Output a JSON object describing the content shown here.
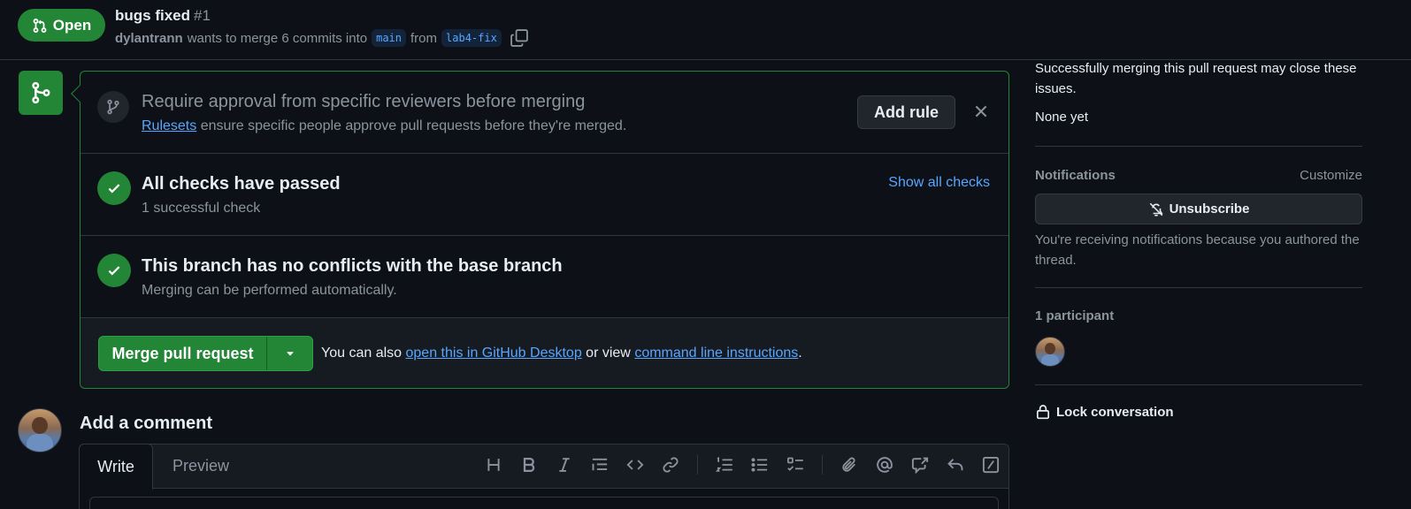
{
  "header": {
    "state": "Open",
    "title": "bugs fixed",
    "number": "#1",
    "author": "dylantrann",
    "merge_text": "wants to merge 6 commits into",
    "base_branch": "main",
    "from_text": "from",
    "head_branch": "lab4-fix"
  },
  "merge_box": {
    "rule_title": "Require approval from specific reviewers before merging",
    "rule_link": "Rulesets",
    "rule_desc": "ensure specific people approve pull requests before they're merged.",
    "add_rule": "Add rule",
    "checks_title": "All checks have passed",
    "checks_sub": "1 successful check",
    "show_checks": "Show all checks",
    "conflict_title": "This branch has no conflicts with the base branch",
    "conflict_sub": "Merging can be performed automatically.",
    "merge_button": "Merge pull request",
    "hint_pre": "You can also",
    "hint_link1": "open this in GitHub Desktop",
    "hint_mid": "or view",
    "hint_link2": "command line instructions",
    "hint_end": "."
  },
  "comment": {
    "heading": "Add a comment",
    "tab_write": "Write",
    "tab_preview": "Preview",
    "toolbar_icons": [
      "heading-icon",
      "bold-icon",
      "italic-icon",
      "quote-icon",
      "code-icon",
      "link-icon",
      "ordered-list-icon",
      "unordered-list-icon",
      "task-list-icon",
      "attach-icon",
      "mention-icon",
      "cross-reference-icon",
      "reply-icon",
      "slash-command-icon"
    ]
  },
  "sidebar": {
    "issues_text": "Successfully merging this pull request may close these issues.",
    "issues_value": "None yet",
    "notifications_label": "Notifications",
    "customize": "Customize",
    "unsubscribe": "Unsubscribe",
    "notif_reason": "You're receiving notifications because you authored the thread.",
    "participants": "1 participant",
    "lock": "Lock conversation"
  },
  "colors": {
    "background": "#0d1117",
    "accent_green": "#238636",
    "link_blue": "#58a6ff",
    "muted": "#8b949e",
    "border": "#30363d"
  }
}
